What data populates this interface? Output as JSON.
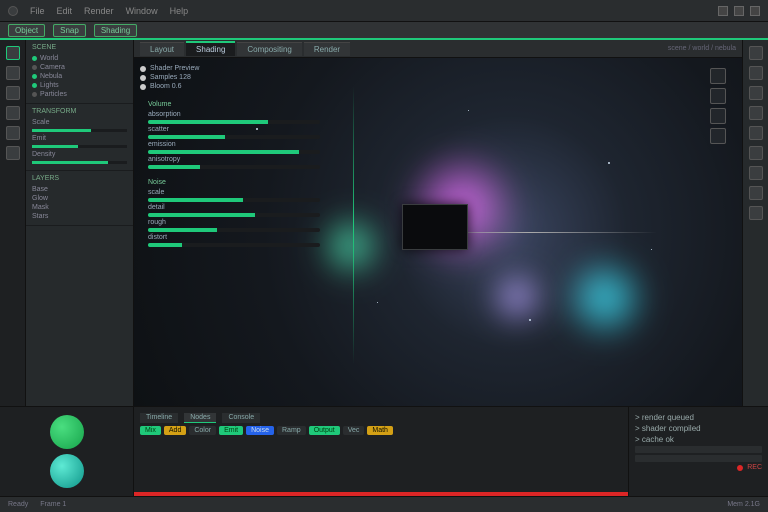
{
  "menubar": {
    "items": [
      "File",
      "Edit",
      "Render",
      "Window",
      "Help"
    ]
  },
  "toolbar": {
    "mode": "Object",
    "snap": "Snap",
    "shading": "Shading"
  },
  "tabs": {
    "items": [
      "Layout",
      "Shading",
      "Compositing",
      "Render"
    ],
    "active": 1,
    "path": "scene / world / nebula"
  },
  "sidebar_tools": {
    "labels": [
      "select",
      "move",
      "rotate",
      "scale",
      "annotate",
      "measure"
    ]
  },
  "outliner": {
    "header": "Scene",
    "items": [
      {
        "label": "World",
        "on": true
      },
      {
        "label": "Camera",
        "on": false
      },
      {
        "label": "Nebula",
        "on": true
      },
      {
        "label": "Lights",
        "on": true
      },
      {
        "label": "Particles",
        "on": false
      }
    ]
  },
  "params": {
    "header": "Transform",
    "rows": [
      {
        "label": "Scale",
        "pct": 62
      },
      {
        "label": "Emit",
        "pct": 48
      },
      {
        "label": "Density",
        "pct": 80
      }
    ]
  },
  "layers": {
    "header": "Layers",
    "rows": [
      "Base",
      "Glow",
      "Mask",
      "Stars"
    ]
  },
  "overlay": {
    "top": [
      {
        "label": "Shader Preview"
      },
      {
        "label": "Samples 128"
      },
      {
        "label": "Bloom 0.6"
      }
    ],
    "group1": {
      "header": "Volume",
      "rows": [
        "absorption",
        "scatter",
        "emission",
        "anisotropy"
      ],
      "bars": [
        70,
        45,
        88,
        30
      ]
    },
    "group2": {
      "header": "Noise",
      "rows": [
        "scale",
        "detail",
        "rough",
        "distort"
      ],
      "bars": [
        55,
        62,
        40,
        20
      ]
    }
  },
  "overlay_tools": [
    "gizmo",
    "overlay",
    "xray",
    "shade"
  ],
  "props_icons": [
    "render",
    "output",
    "view",
    "world",
    "object",
    "modifier",
    "particle",
    "physics",
    "material"
  ],
  "bottom": {
    "tabs": [
      "Timeline",
      "Nodes",
      "Console"
    ],
    "active": 1,
    "chips": [
      "Mix",
      "Add",
      "Color",
      "Emit",
      "Noise",
      "Ramp",
      "Output",
      "Vec",
      "Math"
    ],
    "log": [
      "> render queued",
      "> shader compiled",
      "> cache ok"
    ],
    "rec": "REC"
  },
  "status": {
    "left": "Ready",
    "mid": "Frame 1",
    "right": "Mem 2.1G"
  },
  "colors": {
    "accent": "#1fc97a"
  }
}
